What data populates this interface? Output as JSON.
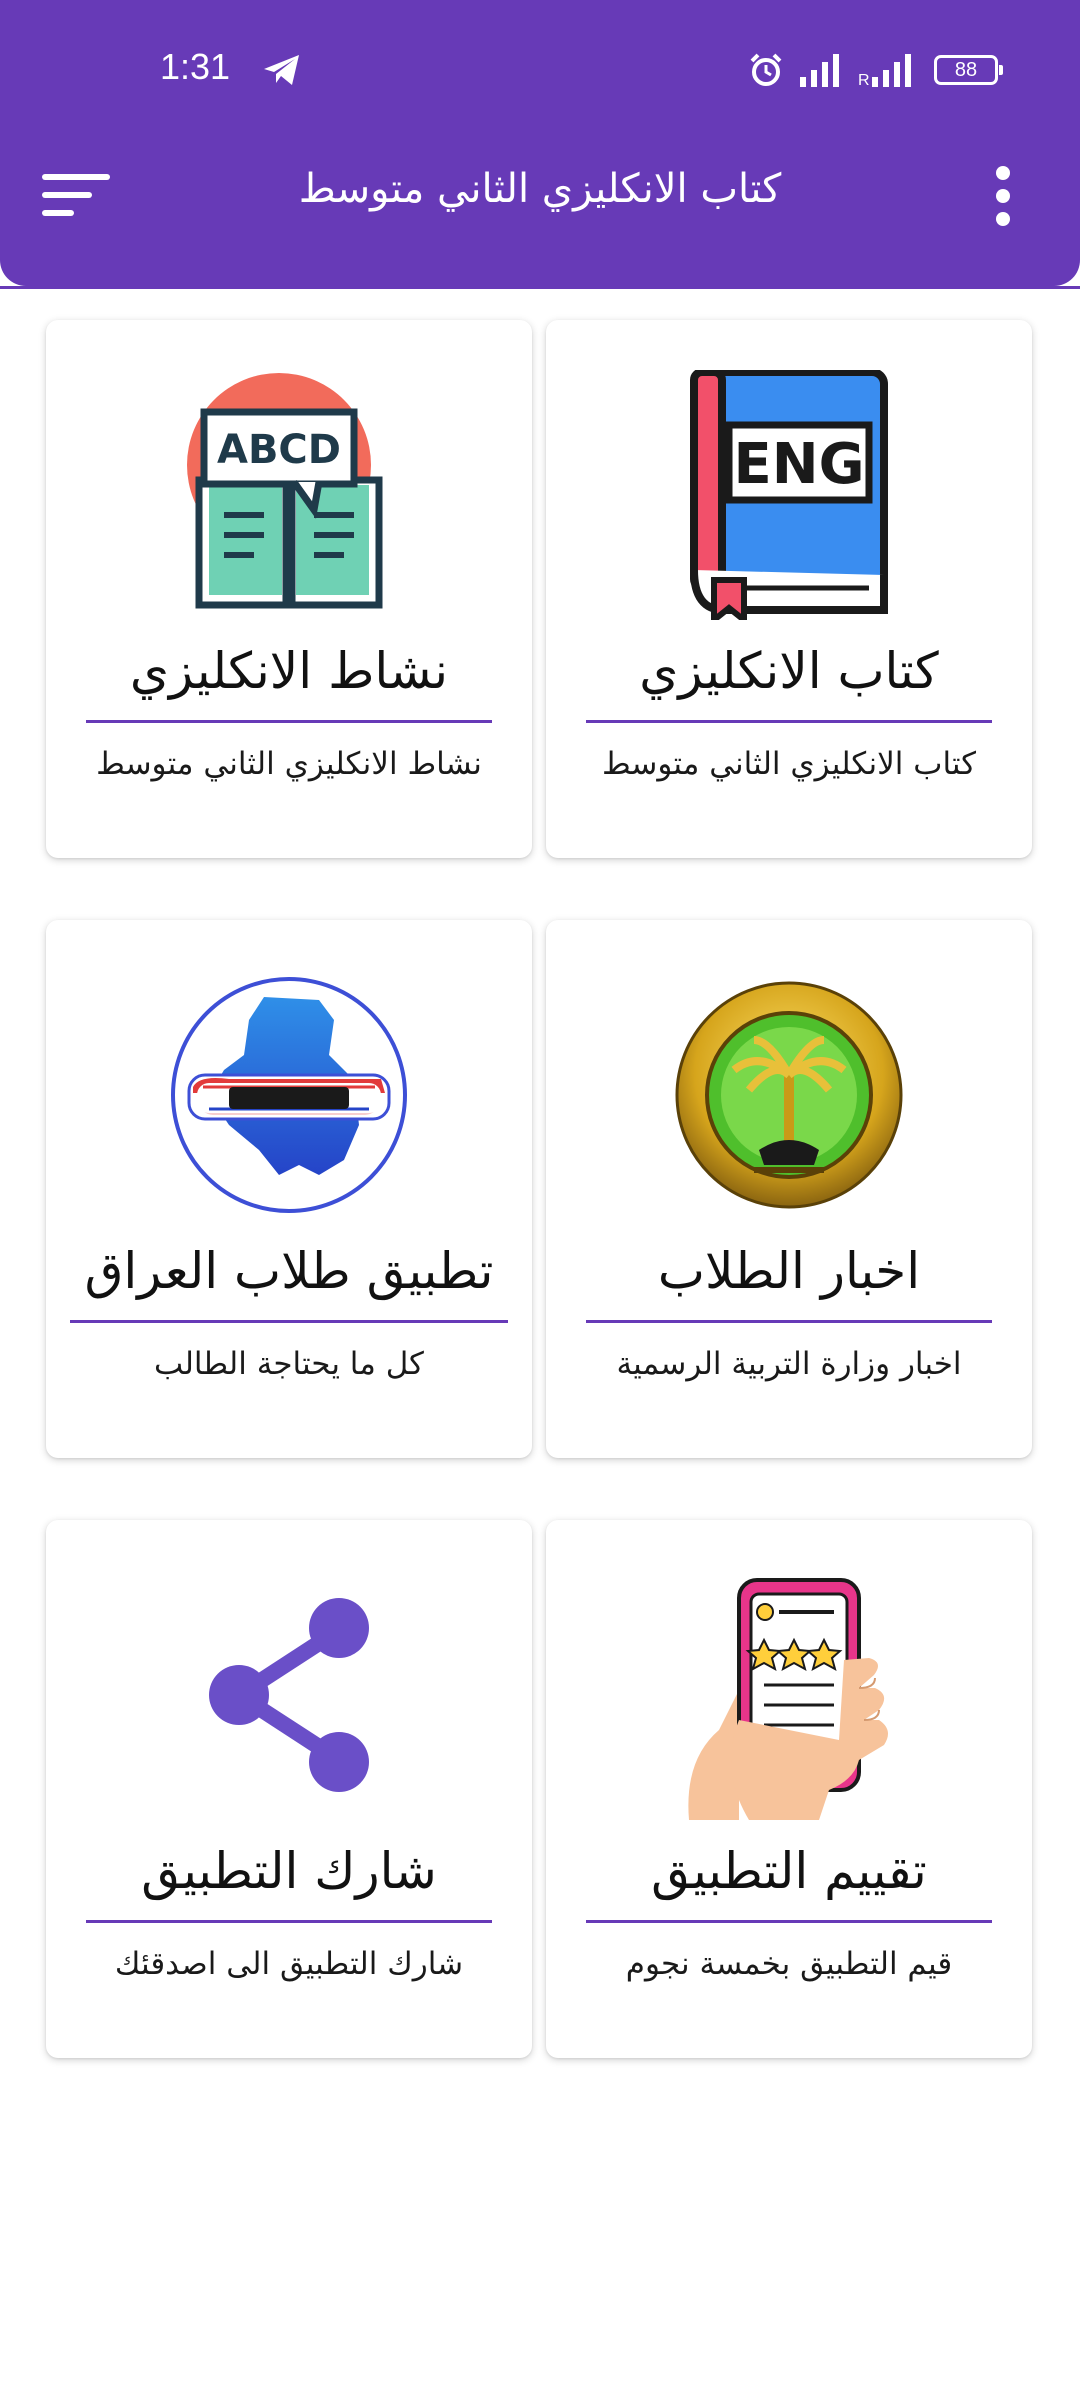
{
  "status_bar": {
    "time": "1:31",
    "battery": "88"
  },
  "app_bar": {
    "title": "كتاب الانكليزي الثاني متوسط"
  },
  "cards": [
    {
      "title": "كتاب الانكليزي",
      "subtitle": "كتاب الانكليزي الثاني متوسط",
      "icon": "book-eng-icon",
      "icon_text": "ENG"
    },
    {
      "title": "نشاط الانكليزي",
      "subtitle": "نشاط الانكليزي الثاني متوسط",
      "icon": "activity-book-icon",
      "icon_text": "ABCD"
    },
    {
      "title": "اخبار الطلاب",
      "subtitle": "اخبار وزارة التربية الرسمية",
      "icon": "ministry-seal-icon"
    },
    {
      "title": "تطبيق طلاب العراق",
      "subtitle": "كل ما يحتاجة الطالب",
      "icon": "iraq-students-logo-icon"
    },
    {
      "title": "تقييم التطبيق",
      "subtitle": "قيم التطبيق بخمسة نجوم",
      "icon": "rate-app-icon"
    },
    {
      "title": "شارك التطبيق",
      "subtitle": "شارك التطبيق الى اصدقئك",
      "icon": "share-icon"
    }
  ],
  "colors": {
    "primary": "#673ab7",
    "divider": "#673ab7"
  }
}
